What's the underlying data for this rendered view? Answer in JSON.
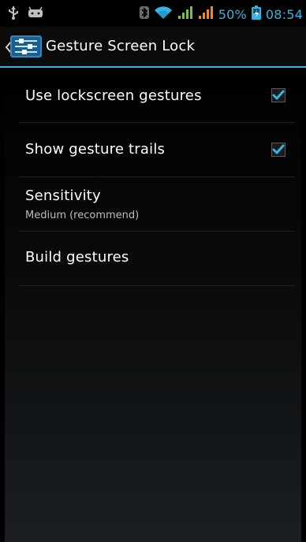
{
  "status_bar": {
    "battery_text": "50%",
    "time": "08:54",
    "icons": [
      "usb-icon",
      "android-icon",
      "bluetooth-icon",
      "wifi-icon",
      "signal-icon-1",
      "signal-icon-2",
      "battery-icon"
    ]
  },
  "action_bar": {
    "title": "Gesture Screen Lock",
    "icons": [
      "chevron-left-icon",
      "settings-sliders-icon"
    ]
  },
  "preferences": [
    {
      "title": "Use lockscreen gestures",
      "checked": true
    },
    {
      "title": "Show gesture trails",
      "checked": true
    },
    {
      "title": "Sensitivity",
      "summary": "Medium (recommend)"
    },
    {
      "title": "Build gestures"
    }
  ],
  "colors": {
    "accent": "#33b5e5",
    "status_text": "#35b5e5",
    "background": "#000000",
    "summary_text": "#bdbdbd"
  }
}
